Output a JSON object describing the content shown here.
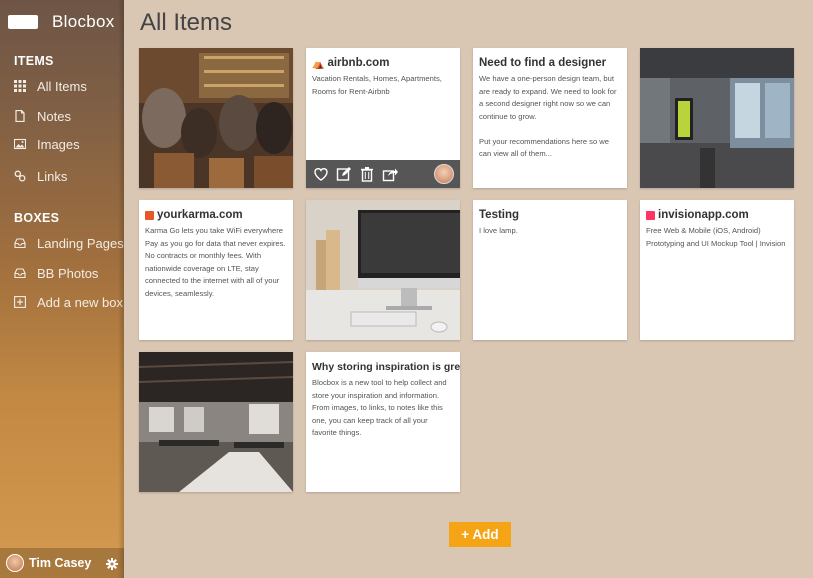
{
  "app": {
    "name": "Blocbox"
  },
  "sidebar": {
    "items_title": "ITEMS",
    "items": [
      {
        "label": "All Items",
        "icon": "grid-icon"
      },
      {
        "label": "Notes",
        "icon": "note-icon"
      },
      {
        "label": "Images",
        "icon": "image-icon"
      },
      {
        "label": "Links",
        "icon": "link-icon"
      }
    ],
    "boxes_title": "BOXES",
    "boxes": [
      {
        "label": "Landing Pages",
        "icon": "inbox-icon"
      },
      {
        "label": "BB Photos",
        "icon": "inbox-icon"
      },
      {
        "label": "Add a new box",
        "icon": "plus-square-icon"
      }
    ],
    "user": {
      "name": "Tim Casey"
    }
  },
  "main": {
    "title": "All Items",
    "add_label": "+ Add",
    "cards": [
      {
        "type": "image",
        "subject": "people at bar"
      },
      {
        "type": "link",
        "title": "airbnb.com",
        "body": "Vacation Rentals, Homes, Apartments, Rooms for Rent-Airbnb",
        "favicon_color": "#ff5a5f"
      },
      {
        "type": "note",
        "title": "Need to find a designer",
        "body": "We have a one-person design team, but are ready to expand. We need to look for a second designer right now so we can continue to grow.\n\nPut your recommendations here so we can view all of them..."
      },
      {
        "type": "image",
        "subject": "office hallway"
      },
      {
        "type": "link",
        "title": "yourkarma.com",
        "body": "Karma Go lets you take WiFi everywhere Pay as you go for data that never expires. No contracts or monthly fees. With nationwide coverage on LTE, stay connected to the internet with all of your devices, seamlessly.",
        "favicon_color": "#e8562a"
      },
      {
        "type": "image",
        "subject": "desk with computer"
      },
      {
        "type": "note",
        "title": "Testing",
        "body": "I love lamp."
      },
      {
        "type": "link",
        "title": "invisionapp.com",
        "body": "Free Web & Mobile (iOS, Android) Prototyping and UI Mockup Tool | Invision",
        "favicon_color": "#ff3366"
      },
      {
        "type": "image",
        "subject": "open office loft"
      },
      {
        "type": "note",
        "title": "Why storing inspiration is great",
        "body": "Blocbox is a new tool to help collect and store your inspiration and information. From images, to links, to notes like this one, you can keep track of all your favorite things."
      }
    ]
  },
  "colors": {
    "accent": "#f5a415",
    "background": "#d9c6b3",
    "action_bar": "#565656"
  }
}
